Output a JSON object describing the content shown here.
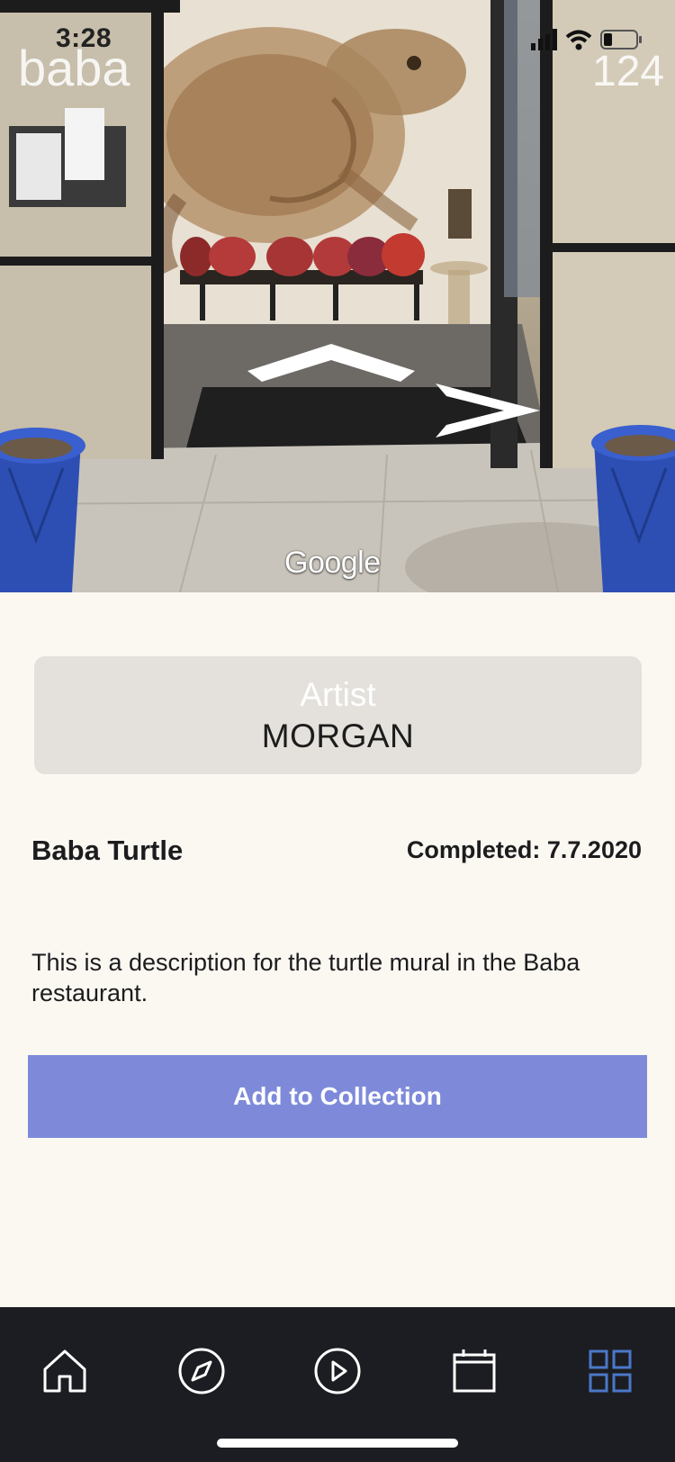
{
  "status_bar": {
    "time": "3:28"
  },
  "street_view": {
    "watermark": "Google",
    "signage_text": "baba",
    "address_number": "124"
  },
  "artist": {
    "label": "Artist",
    "name": "MORGAN"
  },
  "mural": {
    "title": "Baba Turtle",
    "completed": "Completed: 7.7.2020",
    "description": "This is a description for the turtle mural in the Baba restaurant."
  },
  "actions": {
    "add_to_collection": "Add to Collection"
  },
  "tab_bar": {
    "tabs": [
      {
        "icon": "home-icon",
        "active": false
      },
      {
        "icon": "compass-icon",
        "active": false
      },
      {
        "icon": "play-icon",
        "active": false
      },
      {
        "icon": "calendar-icon",
        "active": false
      },
      {
        "icon": "grid-icon",
        "active": true
      }
    ],
    "active_color": "#4a78c8",
    "inactive_color": "#ffffff"
  },
  "colors": {
    "accent_button": "#7e8ad9",
    "background": "#fbf8f2",
    "tab_bar_bg": "#1c1d22"
  }
}
